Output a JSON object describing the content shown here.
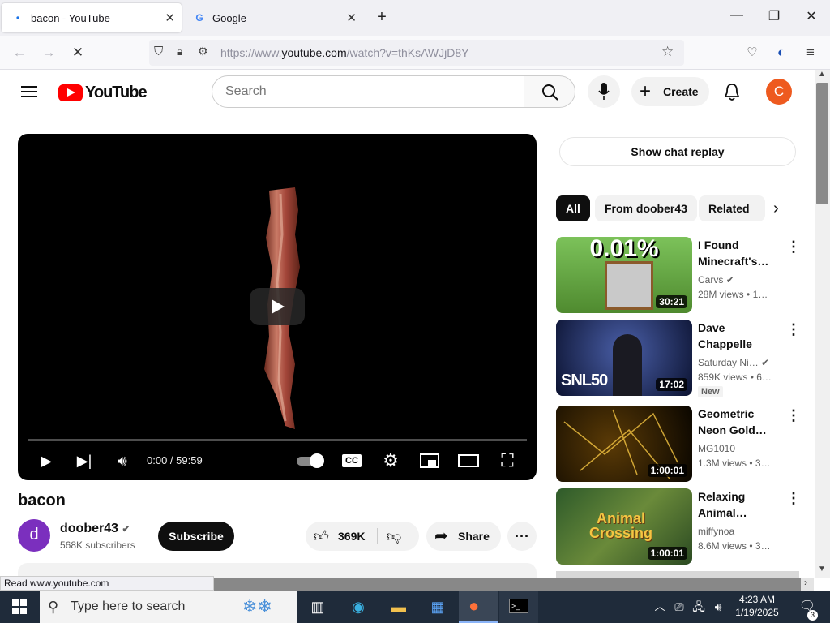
{
  "browser": {
    "tabs": [
      {
        "title": "bacon - YouTube",
        "active": true
      },
      {
        "title": "Google",
        "active": false
      }
    ],
    "url_prefix": "https://www.",
    "url_domain": "youtube.com",
    "url_path": "/watch?v=thKsAWJjD8Y",
    "status_text": "Read www.youtube.com"
  },
  "youtube": {
    "logo_text": "YouTube",
    "search_placeholder": "Search",
    "create_label": "Create",
    "avatar_letter": "C",
    "brand_red": "#ff0000"
  },
  "player": {
    "time": "0:00 / 59:59"
  },
  "video": {
    "title": "bacon",
    "channel": "doober43",
    "channel_letter": "d",
    "subscribers": "568K subscribers",
    "subscribe_label": "Subscribe",
    "likes": "369K",
    "share_label": "Share"
  },
  "sidebar": {
    "chat_replay": "Show chat replay",
    "chips": [
      "All",
      "From doober43",
      "Related"
    ],
    "recommendations": [
      {
        "title": "I Found Minecraft's…",
        "channel": "Carvs",
        "verified": true,
        "views": "28M views",
        "age": "1…",
        "duration": "30:21",
        "overlay": "0.01%",
        "new": ""
      },
      {
        "title": "Dave Chappelle Stand-Up…",
        "channel": "Saturday Ni…",
        "verified": true,
        "views": "859K views",
        "age": "6…",
        "duration": "17:02",
        "overlay": "SNL50",
        "new": "New"
      },
      {
        "title": "Geometric Neon Gold…",
        "channel": "MG1010",
        "verified": false,
        "views": "1.3M views",
        "age": "3…",
        "duration": "1:00:01",
        "overlay": "",
        "new": ""
      },
      {
        "title": "Relaxing Animal…",
        "channel": "miffynoa",
        "verified": false,
        "views": "8.6M views",
        "age": "3…",
        "duration": "1:00:01",
        "overlay": "Animal Crossing",
        "new": ""
      }
    ]
  },
  "taskbar": {
    "search_placeholder": "Type here to search",
    "time": "4:23 AM",
    "date": "1/19/2025",
    "notification_count": "3"
  }
}
